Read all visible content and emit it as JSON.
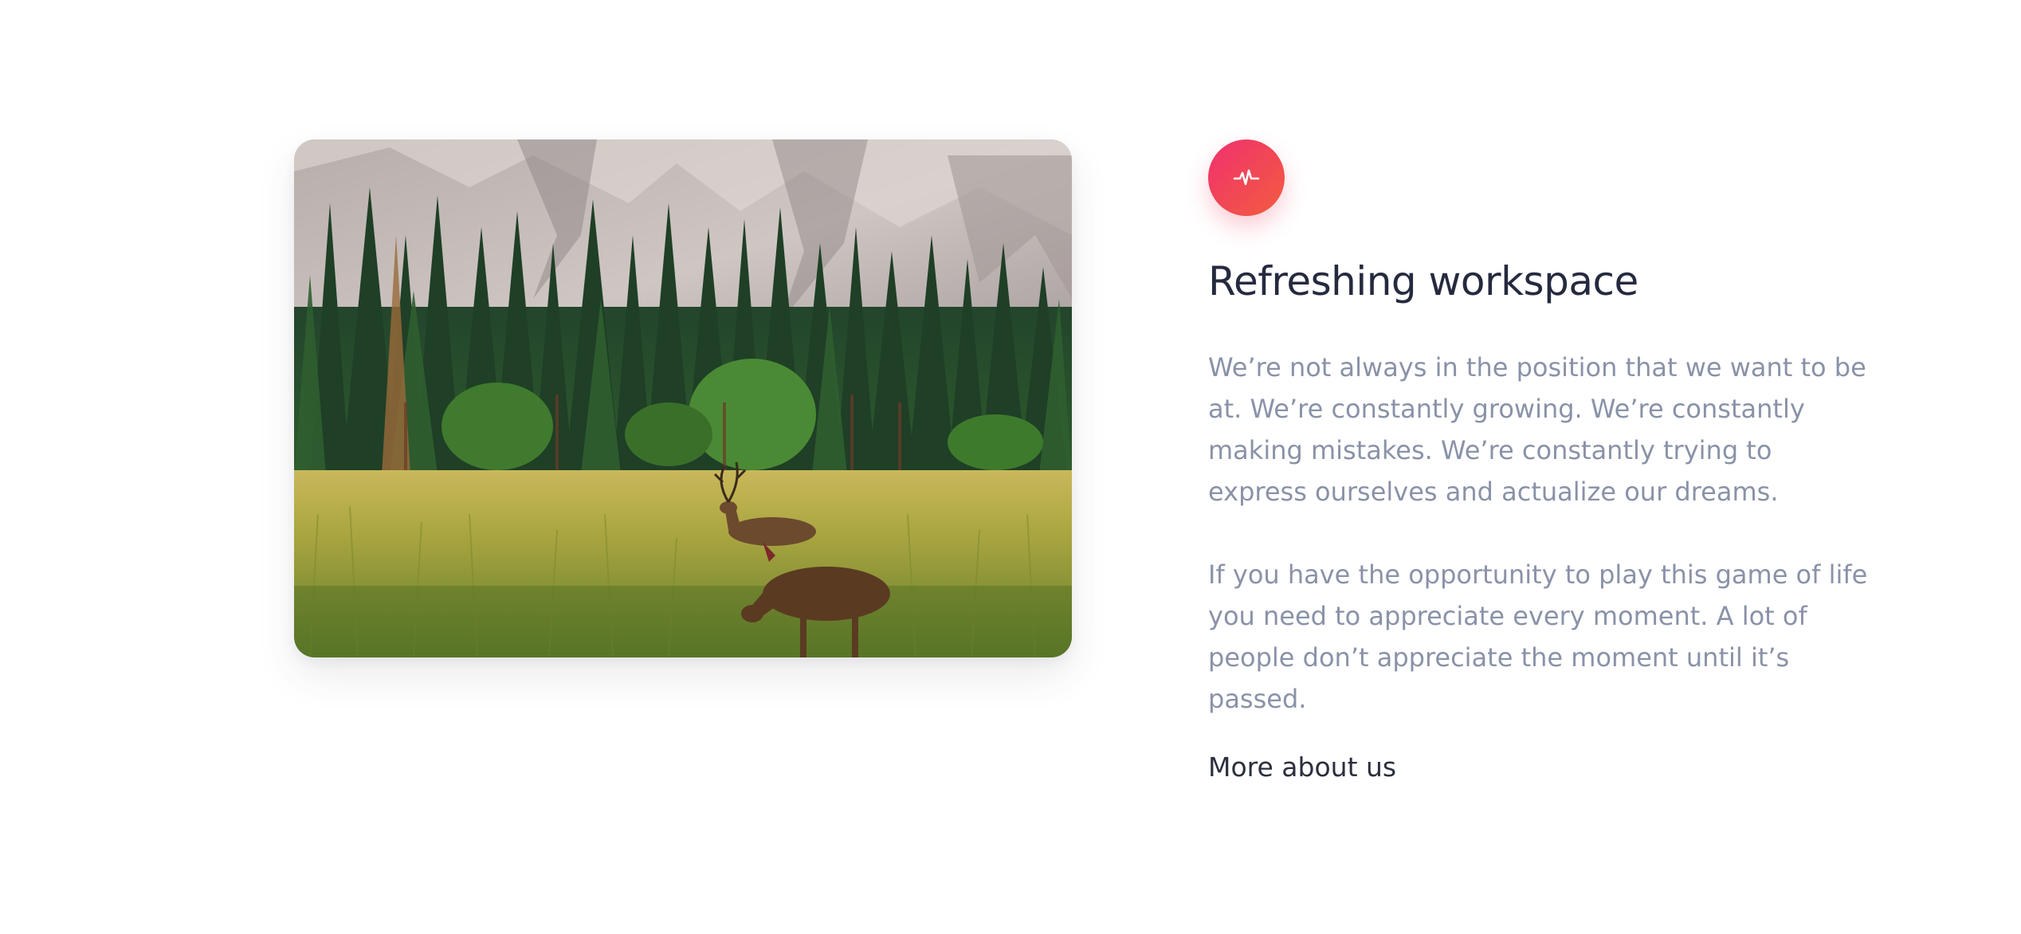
{
  "feature": {
    "image_alt": "Deer grazing in a meadow below a forest and granite cliffs",
    "icon": "pulse-icon",
    "accent_gradient": [
      "#f0306e",
      "#f25d3f"
    ],
    "title": "Refreshing workspace",
    "paragraph_1": "We’re not always in the position that we want to be at. We’re constantly growing. We’re constantly making mistakes. We’re constantly trying to express ourselves and actualize our dreams.",
    "paragraph_2": "If you have the opportunity to play this game of life you need to appreciate every moment. A lot of people don’t appreciate the moment until it’s passed.",
    "link_label": "More about us"
  }
}
